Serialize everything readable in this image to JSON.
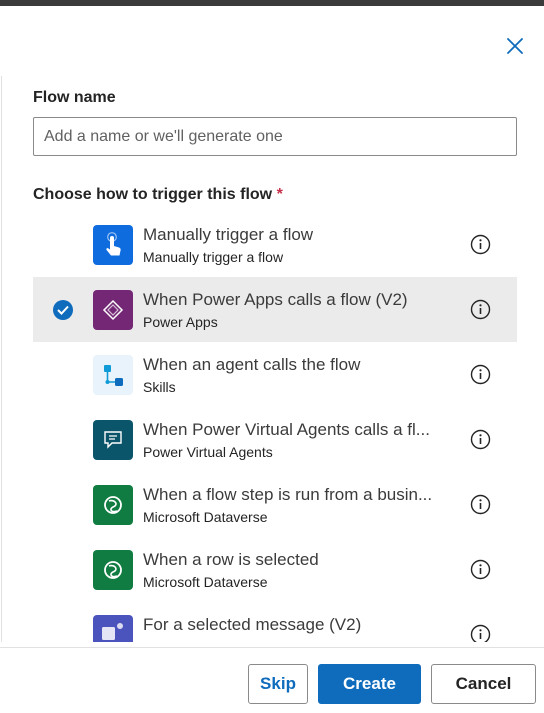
{
  "dialog": {
    "close_icon": "close-icon",
    "flow_name_label": "Flow name",
    "flow_name_placeholder": "Add a name or we'll generate one",
    "flow_name_value": "",
    "trigger_label": "Choose how to trigger this flow",
    "required_marker": "*"
  },
  "triggers": [
    {
      "title": "Manually trigger a flow",
      "subtitle": "Manually trigger a flow",
      "icon": "hand-tap-icon",
      "icon_color": "#0f6cde",
      "selected": false
    },
    {
      "title": "When Power Apps calls a flow (V2)",
      "subtitle": "Power Apps",
      "icon": "power-apps-icon",
      "icon_color": "#742774",
      "selected": true
    },
    {
      "title": "When an agent calls the flow",
      "subtitle": "Skills",
      "icon": "skills-icon",
      "icon_color": "#e8f3fb",
      "selected": false
    },
    {
      "title": "When Power Virtual Agents calls a fl...",
      "subtitle": "Power Virtual Agents",
      "icon": "chat-bubble-icon",
      "icon_color": "#0b556a",
      "selected": false
    },
    {
      "title": "When a flow step is run from a busin...",
      "subtitle": "Microsoft Dataverse",
      "icon": "dataverse-icon",
      "icon_color": "#107c41",
      "selected": false
    },
    {
      "title": "When a row is selected",
      "subtitle": "Microsoft Dataverse",
      "icon": "dataverse-icon",
      "icon_color": "#107c41",
      "selected": false
    },
    {
      "title": "For a selected message (V2)",
      "subtitle": "",
      "icon": "teams-icon",
      "icon_color": "#4b53bc",
      "selected": false
    }
  ],
  "footer": {
    "skip_label": "Skip",
    "create_label": "Create",
    "cancel_label": "Cancel"
  }
}
